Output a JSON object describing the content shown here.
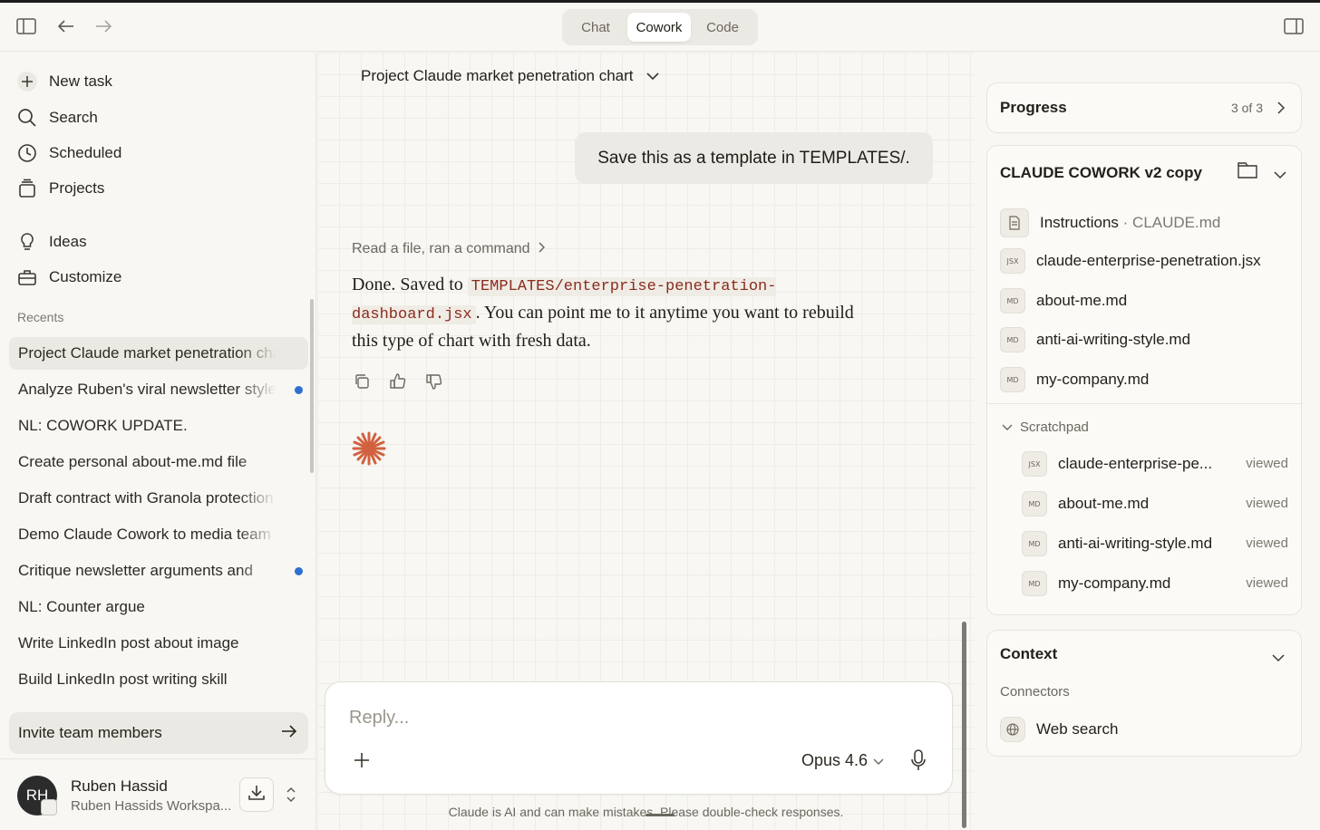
{
  "topbar": {
    "modes": [
      "Chat",
      "Cowork",
      "Code"
    ],
    "active_mode": "Cowork"
  },
  "sidebar": {
    "nav": [
      {
        "label": "New task",
        "icon": "plus-icon"
      },
      {
        "label": "Search",
        "icon": "search-icon"
      },
      {
        "label": "Scheduled",
        "icon": "clock-icon"
      },
      {
        "label": "Projects",
        "icon": "projects-icon"
      },
      {
        "label": "Ideas",
        "icon": "lightbulb-icon"
      },
      {
        "label": "Customize",
        "icon": "toolbox-icon"
      }
    ],
    "recents_label": "Recents",
    "recents": [
      {
        "label": "Project Claude market penetration chart",
        "active": true,
        "unread": false
      },
      {
        "label": "Analyze Ruben's viral newsletter style",
        "active": false,
        "unread": true
      },
      {
        "label": "NL: COWORK UPDATE.",
        "active": false,
        "unread": false
      },
      {
        "label": "Create personal about-me.md file",
        "active": false,
        "unread": false
      },
      {
        "label": "Draft contract with Granola protection",
        "active": false,
        "unread": false
      },
      {
        "label": "Demo Claude Cowork to media team",
        "active": false,
        "unread": false
      },
      {
        "label": "Critique newsletter arguments and",
        "active": false,
        "unread": true
      },
      {
        "label": "NL: Counter argue",
        "active": false,
        "unread": false
      },
      {
        "label": "Write LinkedIn post about image",
        "active": false,
        "unread": false
      },
      {
        "label": "Build LinkedIn post writing skill",
        "active": false,
        "unread": false
      }
    ],
    "invite_label": "Invite team members",
    "user": {
      "initials": "RH",
      "name": "Ruben Hassid",
      "workspace": "Ruben Hassids Workspa..."
    }
  },
  "main": {
    "title": "Project Claude market penetration chart",
    "user_message": "Save this as a template in TEMPLATES/.",
    "tool_summary": "Read a file, ran a command",
    "answer": {
      "prefix": "Done. Saved to ",
      "code": "TEMPLATES/enterprise-penetration-dashboard.jsx",
      "suffix": ". You can point me to it anytime you want to rebuild this type of chart with fresh data."
    },
    "composer": {
      "placeholder": "Reply...",
      "model": "Opus 4.6"
    },
    "disclaimer": "Claude is AI and can make mistakes. Please double-check responses."
  },
  "right_panel": {
    "progress": {
      "title": "Progress",
      "count": "3 of 3"
    },
    "folder": {
      "title": "CLAUDE COWORK v2 copy",
      "instructions": {
        "label": "Instructions",
        "file": "CLAUDE.md"
      },
      "files": [
        {
          "name": "claude-enterprise-penetration.jsx",
          "type": "JSX"
        },
        {
          "name": "about-me.md",
          "type": "MD"
        },
        {
          "name": "anti-ai-writing-style.md",
          "type": "MD"
        },
        {
          "name": "my-company.md",
          "type": "MD"
        }
      ],
      "scratchpad_label": "Scratchpad",
      "scratchpad": [
        {
          "name": "claude-enterprise-pe...",
          "type": "JSX",
          "status": "viewed"
        },
        {
          "name": "about-me.md",
          "type": "MD",
          "status": "viewed"
        },
        {
          "name": "anti-ai-writing-style.md",
          "type": "MD",
          "status": "viewed"
        },
        {
          "name": "my-company.md",
          "type": "MD",
          "status": "viewed"
        }
      ]
    },
    "context": {
      "title": "Context",
      "connectors_label": "Connectors",
      "connectors": [
        {
          "name": "Web search",
          "icon": "globe-icon"
        }
      ]
    }
  },
  "colors": {
    "background": "#f8f7f4",
    "accent_spark": "#d2613f",
    "unread_dot": "#2f6fcf",
    "code_text": "#8b2a1e"
  }
}
